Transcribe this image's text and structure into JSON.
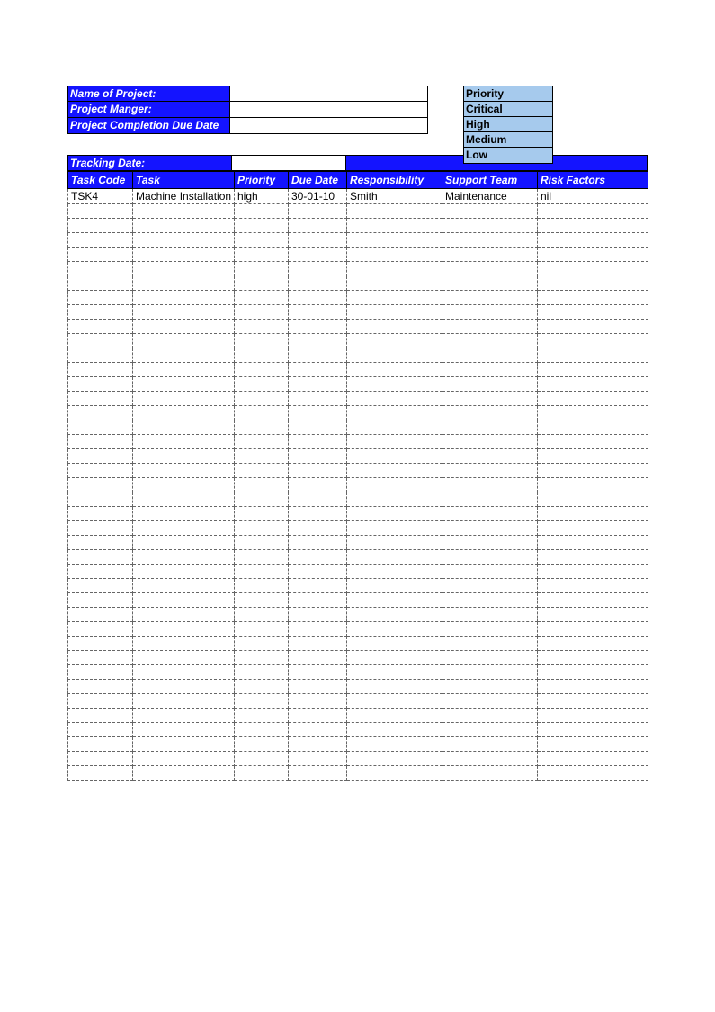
{
  "info": {
    "project_name_label": "Name of Project:",
    "project_name_value": "",
    "project_manager_label": "Project Manger:",
    "project_manager_value": "",
    "completion_due_label": "Project Completion Due Date",
    "completion_due_value": ""
  },
  "legend": {
    "title": "Priority",
    "levels": [
      "Critical",
      "High",
      "Medium",
      "Low"
    ]
  },
  "tracking": {
    "label": "Tracking Date:",
    "value": ""
  },
  "columns": {
    "task_code": "Task Code",
    "task": "Task",
    "priority": "Priority",
    "due_date": "Due Date",
    "responsibility": "Responsibility",
    "support_team": "Support Team",
    "risk_factors": "Risk Factors"
  },
  "rows": [
    {
      "task_code": "TSK4",
      "task": "Machine Installation",
      "priority": "high",
      "due_date": "30-01-10",
      "responsibility": "Smith",
      "support_team": "Maintenance",
      "risk_factors": "nil"
    }
  ],
  "empty_row_count": 40
}
